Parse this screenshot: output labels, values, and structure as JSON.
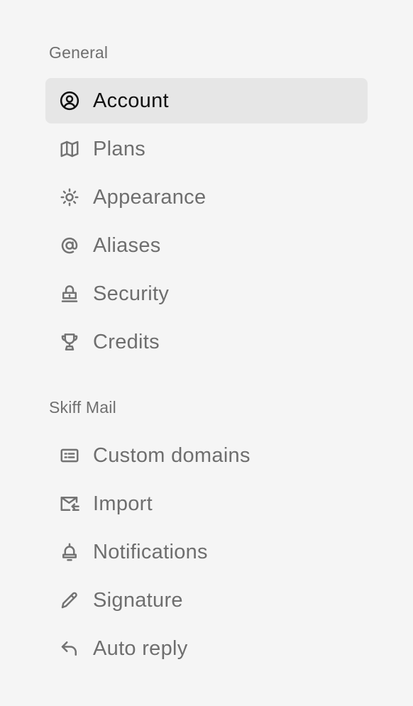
{
  "sections": [
    {
      "title": "General",
      "items": [
        {
          "label": "Account",
          "icon": "user-circle-icon",
          "active": true
        },
        {
          "label": "Plans",
          "icon": "map-icon",
          "active": false
        },
        {
          "label": "Appearance",
          "icon": "sun-icon",
          "active": false
        },
        {
          "label": "Aliases",
          "icon": "at-sign-icon",
          "active": false
        },
        {
          "label": "Security",
          "icon": "lock-icon",
          "active": false
        },
        {
          "label": "Credits",
          "icon": "trophy-icon",
          "active": false
        }
      ]
    },
    {
      "title": "Skiff Mail",
      "items": [
        {
          "label": "Custom domains",
          "icon": "id-card-icon",
          "active": false
        },
        {
          "label": "Import",
          "icon": "import-icon",
          "active": false
        },
        {
          "label": "Notifications",
          "icon": "bell-icon",
          "active": false
        },
        {
          "label": "Signature",
          "icon": "pencil-icon",
          "active": false
        },
        {
          "label": "Auto reply",
          "icon": "reply-arrow-icon",
          "active": false
        }
      ]
    }
  ],
  "colors": {
    "background": "#f5f5f5",
    "active_background": "#e6e6e6",
    "active_text": "#111111",
    "inactive_text": "#6e6e6e",
    "section_title": "#6f6f6f"
  }
}
